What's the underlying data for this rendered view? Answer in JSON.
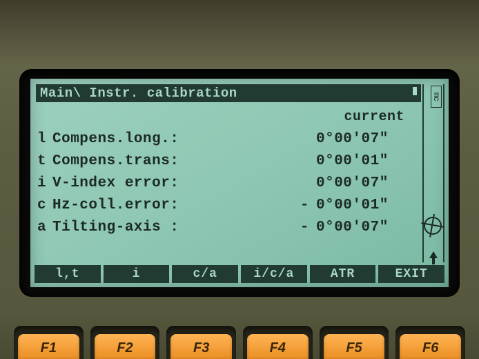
{
  "title": "Main\\  Instr. calibration",
  "column_header": "current",
  "side_label": "mc",
  "rows": [
    {
      "key": "l",
      "label": "Compens.long.:",
      "sign": "",
      "value": "0°00'07\""
    },
    {
      "key": "t",
      "label": "Compens.trans:",
      "sign": "",
      "value": "0°00'01\""
    },
    {
      "key": "i",
      "label": "V-index error:",
      "sign": "",
      "value": "0°00'07\""
    },
    {
      "key": "c",
      "label": "Hz-coll.error:",
      "sign": "-",
      "value": "0°00'01\""
    },
    {
      "key": "a",
      "label": "Tilting-axis :",
      "sign": "-",
      "value": "0°00'07\""
    }
  ],
  "softkeys": [
    "l,t",
    "i",
    "c/a",
    "i/c/a",
    "ATR",
    "EXIT"
  ],
  "hardware_keys": [
    "F1",
    "F2",
    "F3",
    "F4",
    "F5",
    "F6"
  ]
}
